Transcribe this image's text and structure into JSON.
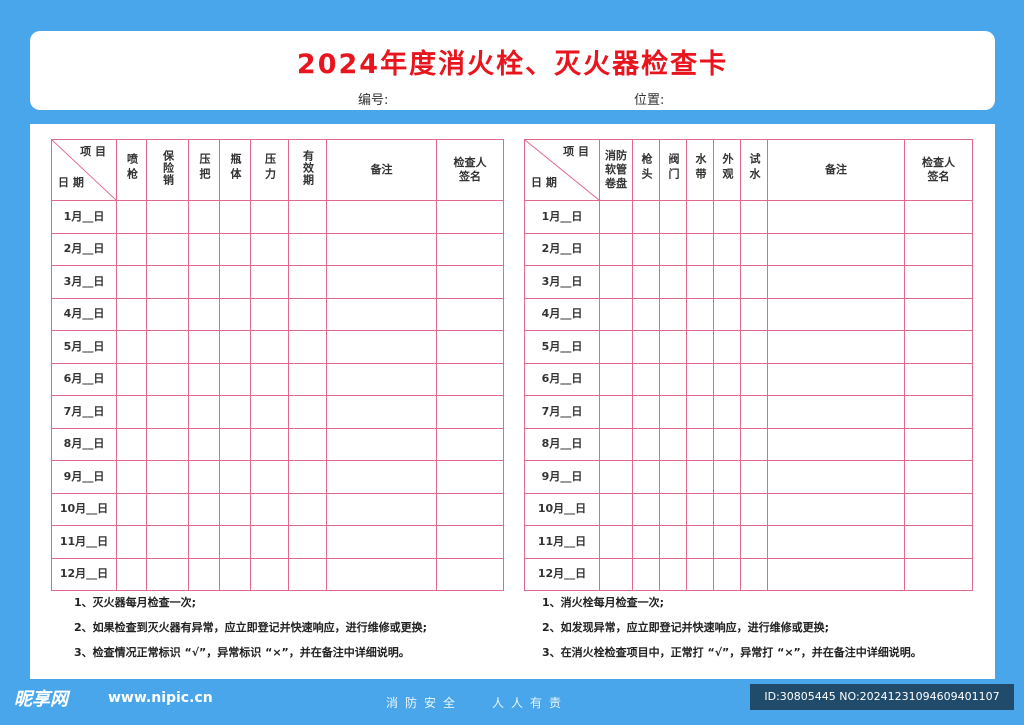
{
  "title": "2024年度消火栓、灭火器检查卡",
  "meta": {
    "number_label": "编号:",
    "location_label": "位置:"
  },
  "diag": {
    "top": "项 目",
    "bottom": "日 期"
  },
  "extinguisher": {
    "columns": [
      "喷枪",
      "保险销",
      "压把",
      "瓶体",
      "压力",
      "有效期",
      "备注",
      "检查人签名"
    ],
    "rows": [
      "1月__日",
      "2月__日",
      "3月__日",
      "4月__日",
      "5月__日",
      "6月__日",
      "7月__日",
      "8月__日",
      "9月__日",
      "10月__日",
      "11月__日",
      "12月__日"
    ],
    "notes": [
      "1、灭火器每月检查一次;",
      "2、如果检查到灭火器有异常，应立即登记并快速响应，进行维修或更换;",
      "3、检查情况正常标识 “√”，异常标识 “×”，并在备注中详细说明。"
    ]
  },
  "hydrant": {
    "columns": [
      "消防软管卷盘",
      "枪头",
      "阀门",
      "水带",
      "外观",
      "试水",
      "备注",
      "检查人签名"
    ],
    "rows": [
      "1月__日",
      "2月__日",
      "3月__日",
      "4月__日",
      "5月__日",
      "6月__日",
      "7月__日",
      "8月__日",
      "9月__日",
      "10月__日",
      "11月__日",
      "12月__日"
    ],
    "notes": [
      "1、消火栓每月检查一次;",
      "2、如发现异常，应立即登记并快速响应，进行维修或更换;",
      "3、在消火栓检查项目中，正常打 “√”，异常打 “×”，并在备注中详细说明。"
    ]
  },
  "footer": {
    "logo": "昵享网",
    "site": "www.nipic.cn",
    "slogan_left": "消防安全",
    "slogan_right": "人人有责",
    "id": "ID:30805445 NO:20241231094609401107"
  }
}
